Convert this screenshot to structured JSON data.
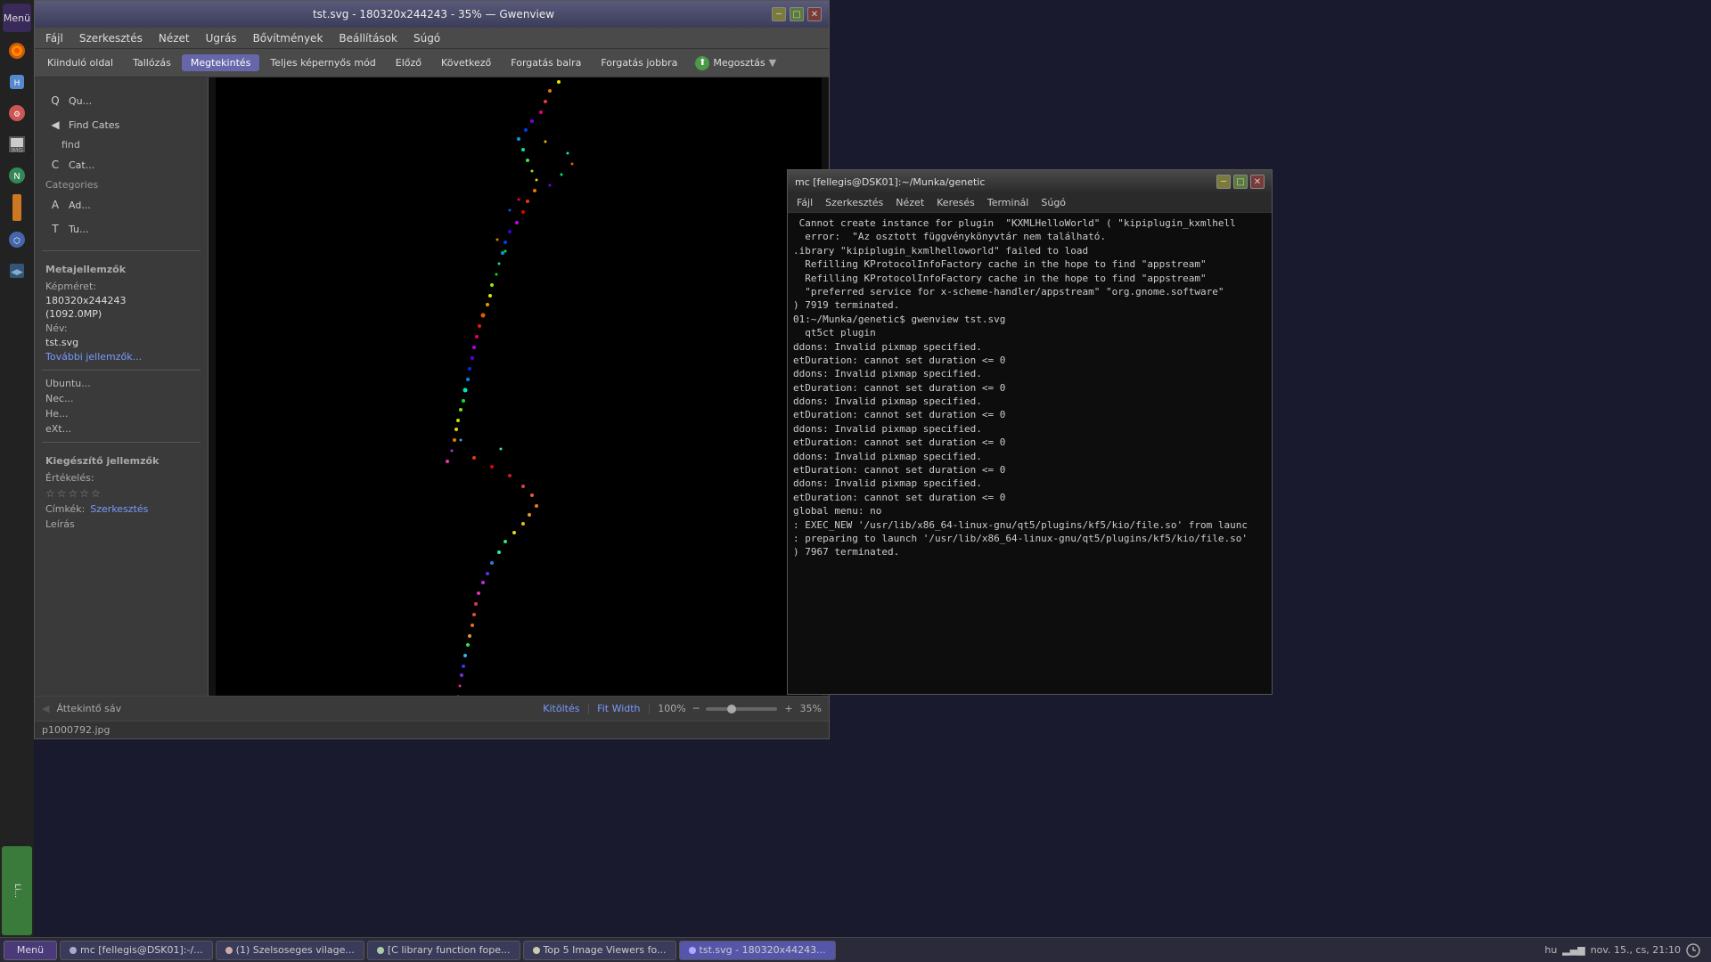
{
  "gwenview": {
    "title": "tst.svg - 180320x244243 - 35% — Gwenview",
    "menubar": {
      "items": [
        "Fájl",
        "Szerkesztés",
        "Nézet",
        "Ugrás",
        "Bővítmények",
        "Beállítások",
        "Súgó"
      ]
    },
    "toolbar": {
      "items": [
        "Kiinduló oldal",
        "Tallózás",
        "Megtekintés",
        "Teljes képernyős mód",
        "Előző",
        "Következő",
        "Forgatás balra",
        "Forgatás jobbra"
      ],
      "share": "Megosztás",
      "active": "Megtekintés"
    },
    "sidebar": {
      "meta_title": "Metajellemzők",
      "size_label": "Képméret:",
      "size_value": "180320x244243",
      "size_mp": "(1092.0MP)",
      "name_label": "Név:",
      "name_value": "tst.svg",
      "more_link": "További jellemzők...",
      "extra_title": "Kiegészítő jellemzők",
      "rating_label": "Értékelés:",
      "tags_label": "Címkék:",
      "tags_link": "Szerkesztés",
      "desc_label": "Leírás",
      "quick_items": [
        "Qu...",
        "Find C...",
        "Cat...",
        "Ad...",
        "Tu..."
      ],
      "quick_labels": [
        "Ubuntu...",
        "Nec...",
        "He...",
        "eXt..."
      ]
    },
    "statusbar": {
      "kitoltes": "Kitöltés",
      "fit_width": "Fit Width",
      "zoom_pct": "100%",
      "zoom_35": "35%",
      "overview": "Áttekintő sáv"
    }
  },
  "terminal": {
    "title": "mc [fellegis@DSK01]:~/Munka/genetic",
    "menubar": [
      "Fájl",
      "Szerkesztés",
      "Nézet",
      "Keresés",
      "Terminál",
      "Súgó"
    ],
    "lines": [
      " Cannot create instance for plugin  \"KXMLHelloWorld\" ( \"kipiplugin_kxmlhell",
      "  error:  \"Az osztott függvénykönyvtár nem található.",
      ".ibrary \"kipiplugin_kxmlhelloworld\" failed to load",
      "  Refilling KProtocolInfoFactory cache in the hope to find \"appstream\"",
      "  Refilling KProtocolInfoFactory cache in the hope to find \"appstream\"",
      "  \"preferred service for x-scheme-handler/appstream\" \"org.gnome.software\"",
      ") 7919 terminated.",
      "01:~/Munka/genetic$ gwenview tst.svg",
      "  qt5ct plugin",
      "ddons: Invalid pixmap specified.",
      "etDuration: cannot set duration <= 0",
      "ddons: Invalid pixmap specified.",
      "etDuration: cannot set duration <= 0",
      "ddons: Invalid pixmap specified.",
      "etDuration: cannot set duration <= 0",
      "ddons: Invalid pixmap specified.",
      "etDuration: cannot set duration <= 0",
      "ddons: Invalid pixmap specified.",
      "etDuration: cannot set duration <= 0",
      "ddons: Invalid pixmap specified.",
      "etDuration: cannot set duration <= 0",
      "global menu: no",
      ": EXEC_NEW '/usr/lib/x86_64-linux-gnu/qt5/plugins/kf5/kio/file.so' from launc",
      ": preparing to launch '/usr/lib/x86_64-linux-gnu/qt5/plugins/kf5/kio/file.so'",
      ") 7967 terminated."
    ]
  },
  "taskbar": {
    "start_label": "Menü",
    "items": [
      {
        "label": "mc [fellegis@DSK01]:-/...",
        "active": false,
        "color": "#aaaacc"
      },
      {
        "label": "(1) Szelsoseges vilage...",
        "active": false,
        "color": "#ccaaaa"
      },
      {
        "label": "[C library function fope...",
        "active": false,
        "color": "#aaccaa"
      },
      {
        "label": "Top 5 Image Viewers fo...",
        "active": false,
        "color": "#ccccaa"
      },
      {
        "label": "tst.svg - 180320x44243...",
        "active": true,
        "color": "#aaaaff"
      }
    ],
    "right": {
      "lang": "hu",
      "signal_bars": "▂▄▆",
      "datetime": "nov. 15., cs, 21:10"
    }
  },
  "image": {
    "filename": "p1000792.jpg",
    "description": "Colorful dot-path SVG visualization on black background"
  },
  "icons": {
    "back": "◀",
    "folder": "📁",
    "settings": "⚙",
    "share_symbol": "⬆",
    "star_empty": "☆",
    "star_filled": "★",
    "close": "✕",
    "minimize": "─",
    "maximize": "□",
    "network": "⬛",
    "battery": "▮"
  }
}
